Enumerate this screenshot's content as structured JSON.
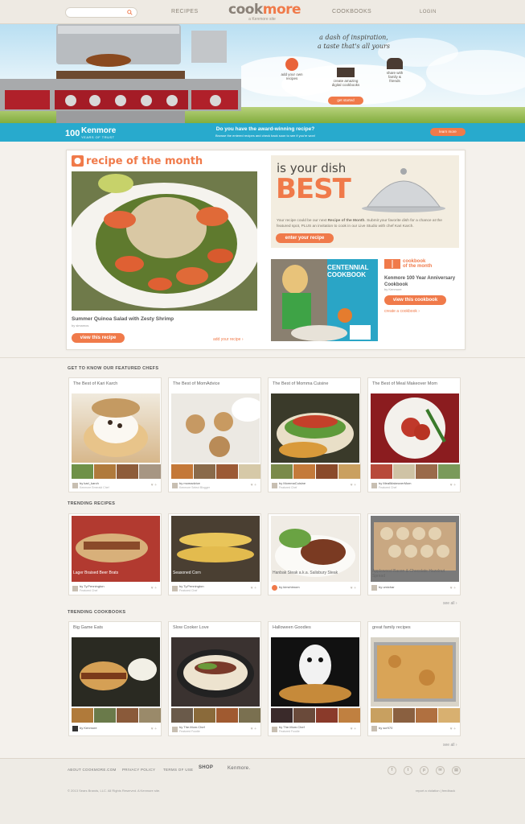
{
  "nav": {
    "search_placeholder": "",
    "recipes": "RECIPES",
    "cookbooks": "COOKBOOKS",
    "login": "LOGIN",
    "logo_cook": "cook",
    "logo_more": "more",
    "logo_sub": "a Kenmore site"
  },
  "hero": {
    "tagline1": "a dash of inspiration,",
    "tagline2": "a taste that's all yours",
    "step1": "add your own recipes",
    "step2": "create amazing digital cookbooks",
    "step3": "share with family & friends",
    "cta": "get started"
  },
  "banner": {
    "brand": "Kenmore",
    "brand_sub": "YEARS OF TRUST",
    "headline": "Do you have the award-winning recipe?",
    "sub": "Browse the entered recipes and check back soon to see if you're won!",
    "cta": "learn more"
  },
  "rotm": {
    "title": "recipe of the month",
    "recipe_name": "Summer Quinoa Salad with Zesty Shrimp",
    "by": "by simamos",
    "view_btn": "view this recipe",
    "add_link": "add your recipe"
  },
  "best": {
    "q": "is your dish",
    "big": "BEST",
    "copy_a": "Your recipe could be our next ",
    "copy_b": "Recipe of the Month",
    "copy_c": ". Submit your favorite dish for a chance at the featured spot, PLUS an invitation to cook in our Live Studio with chef Kari Karch.",
    "enter_btn": "enter your recipe"
  },
  "cookbook_month": {
    "badge1": "cookbook",
    "badge2": "of the month",
    "cover_title": "CENTENNIAL COOKBOOK",
    "name": "Kenmore 100 Year Anniversary Cookbook",
    "by": "by Kenmore",
    "view_btn": "view this cookbook",
    "create_link": "create a cookbook"
  },
  "chefs": {
    "heading": "GET TO KNOW OUR FEATURED CHEFS",
    "items": [
      {
        "title": "The Best of Kari Karch",
        "author": "by kari_karch",
        "role": "Kenmore Emerald Chef"
      },
      {
        "title": "The Best of MomAdvice",
        "author": "by momadvice",
        "role": "Kenmore Select Blogger"
      },
      {
        "title": "The Best of Momma Cuisine",
        "author": "by MommaCuisine",
        "role": "Featured Chef"
      },
      {
        "title": "The Best of Meal Makeover Mom",
        "author": "by MealMakeoverMom",
        "role": "Featured Chef"
      }
    ]
  },
  "trending": {
    "heading": "TRENDING RECIPES",
    "items": [
      {
        "title": "Lager Braised Beer Brats",
        "author": "by Ty.Pennington",
        "role": "Featured Chef"
      },
      {
        "title": "Seasoned Corn",
        "author": "by Ty.Pennington",
        "role": "Featured Chef"
      },
      {
        "title": "Hanbak Steak a.k.a. Salisbury Steak",
        "author": "by kimchimom",
        "role": ""
      },
      {
        "title": "Applewood Bacon & Chocolate Hazelnut Spread",
        "author": "by umichar",
        "role": ""
      }
    ],
    "see_all": "see all"
  },
  "cookbooks": {
    "heading": "TRENDING COOKBOOKS",
    "items": [
      {
        "title": "Big Game Eats",
        "author": "by Kenmore",
        "role": ""
      },
      {
        "title": "Slow Cooker Love",
        "author": "by The.Mom.Chef",
        "role": "Featured Foodie"
      },
      {
        "title": "Halloween Goodies",
        "author": "by The.Mom.Chef",
        "role": "Featured Foodie"
      },
      {
        "title": "great family recipes",
        "author": "by scr970",
        "role": ""
      }
    ],
    "see_all": "see all"
  },
  "footer": {
    "about": "ABOUT COOKMORE.COM",
    "privacy": "PRIVACY POLICY",
    "terms": "TERMS OF USE",
    "shop": "SHOP",
    "kenmore": "Kenmore.",
    "copyright": "© 2013 Sears Brands, LLC. All Rights Reserved. A Kenmore site.",
    "report": "report a violation",
    "feedback": "feedback"
  },
  "colors": {
    "accent": "#f07a4a",
    "banner": "#28aacd"
  }
}
